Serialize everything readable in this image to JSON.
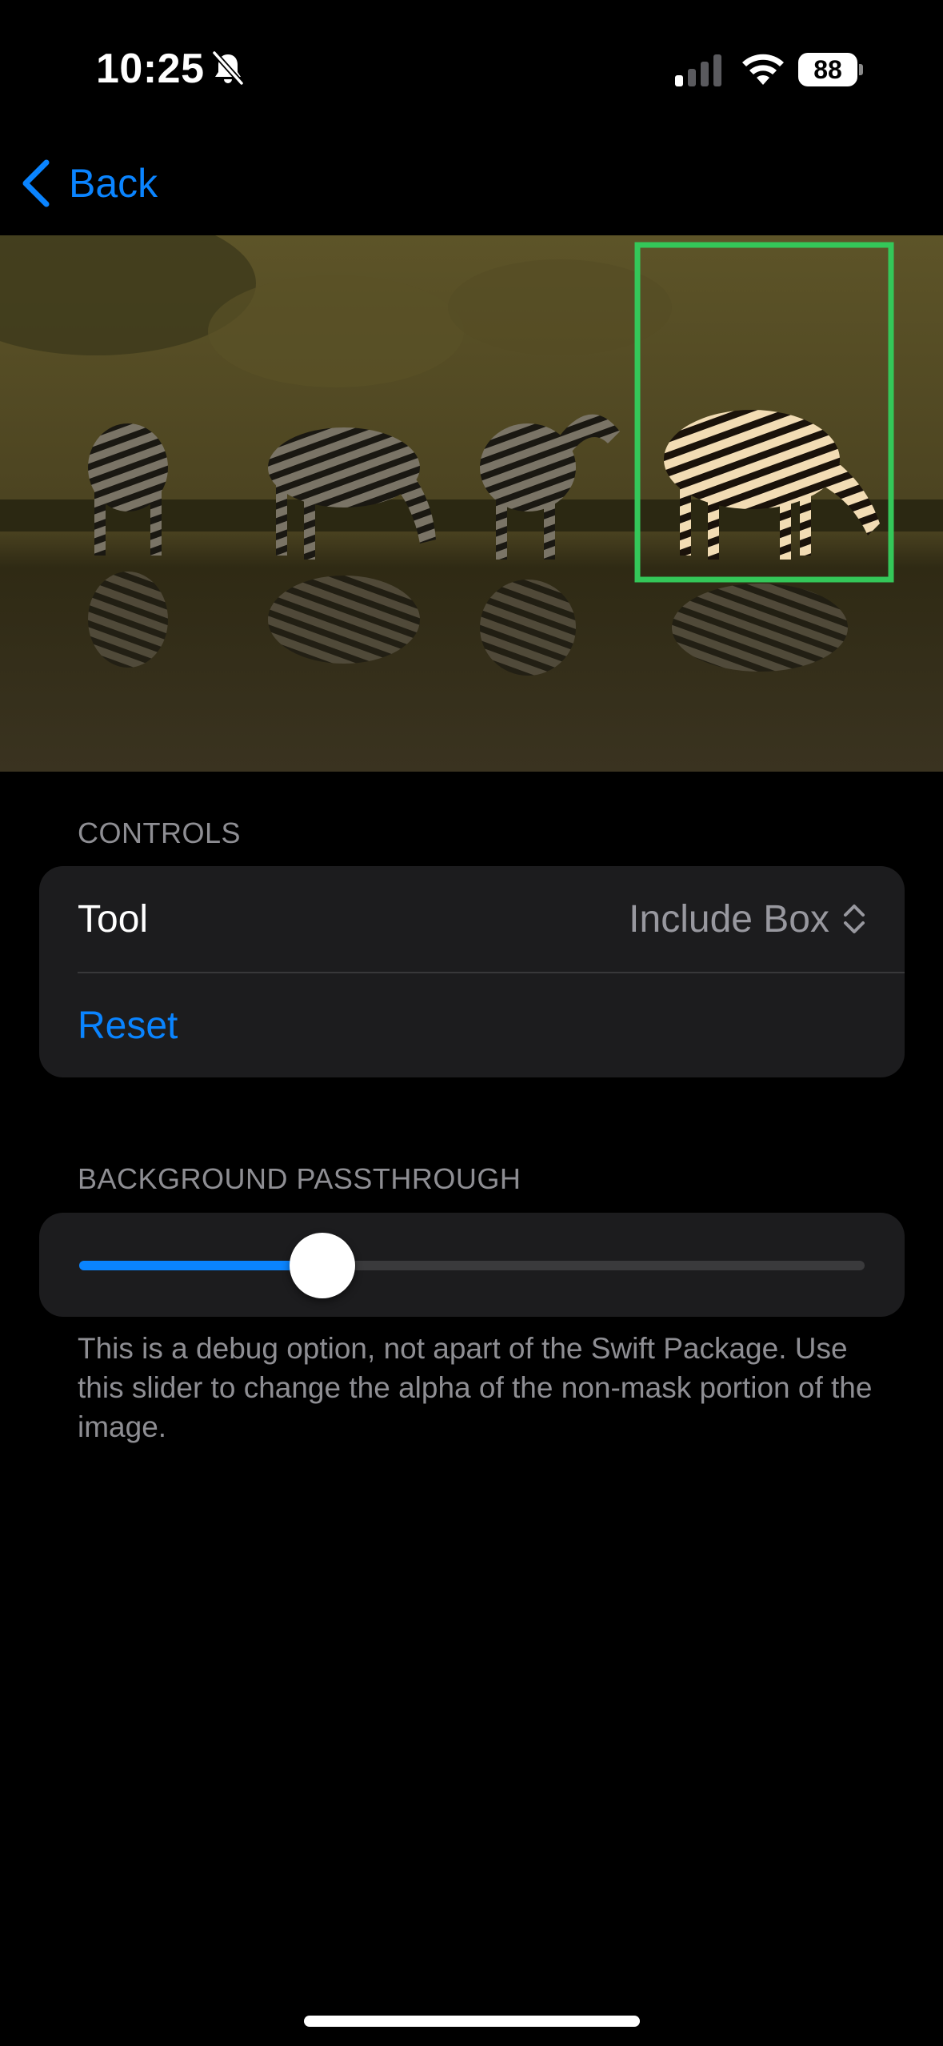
{
  "status_bar": {
    "time": "10:25",
    "battery": "88",
    "icons": [
      "bell-slash-icon",
      "cellular-signal-icon",
      "wifi-icon",
      "battery-icon"
    ]
  },
  "nav": {
    "back_label": "Back",
    "back_icon": "chevron-left-icon",
    "accent_color": "#0a84ff"
  },
  "image": {
    "subject": "zebras",
    "selection_box_color": "#34c759"
  },
  "controls": {
    "header": "CONTROLS",
    "tool_label": "Tool",
    "tool_value": "Include Box",
    "tool_value_icon": "chevron-up-down-icon",
    "reset_label": "Reset"
  },
  "passthrough": {
    "header": "BACKGROUND PASSTHROUGH",
    "slider_value": 0.31,
    "footnote": "This is a debug option, not apart of the Swift Package. Use this slider to change the alpha of the non-mask portion of the image."
  }
}
